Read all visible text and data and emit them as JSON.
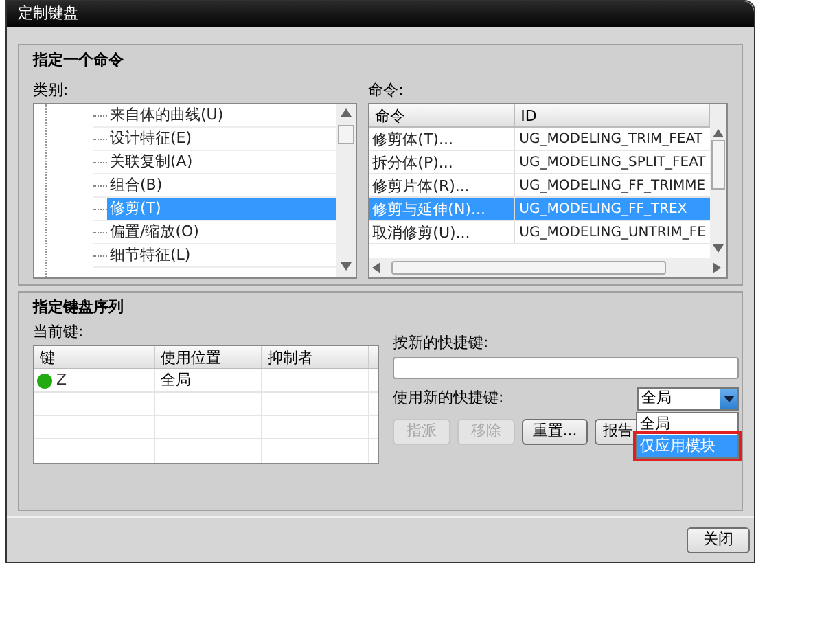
{
  "window": {
    "title": "定制键盘"
  },
  "command_section": {
    "title": "指定一个命令",
    "category_label": "类别:",
    "categories": [
      {
        "label": "来自体的曲线(U)",
        "selected": false
      },
      {
        "label": "设计特征(E)",
        "selected": false
      },
      {
        "label": "关联复制(A)",
        "selected": false
      },
      {
        "label": "组合(B)",
        "selected": false
      },
      {
        "label": "修剪(T)",
        "selected": true
      },
      {
        "label": "偏置/缩放(O)",
        "selected": false
      },
      {
        "label": "细节特征(L)",
        "selected": false
      }
    ],
    "commands_label": "命令:",
    "columns": [
      "命令",
      "ID"
    ],
    "commands": [
      {
        "name": "修剪体(T)...",
        "id": "UG_MODELING_TRIM_FEAT",
        "selected": false
      },
      {
        "name": "拆分体(P)...",
        "id": "UG_MODELING_SPLIT_FEAT",
        "selected": false
      },
      {
        "name": "修剪片体(R)...",
        "id": "UG_MODELING_FF_TRIMME",
        "selected": false
      },
      {
        "name": "修剪与延伸(N)...",
        "id": "UG_MODELING_FF_TREX",
        "selected": true
      },
      {
        "name": "取消修剪(U)...",
        "id": "UG_MODELING_UNTRIM_FE",
        "selected": false
      }
    ]
  },
  "key_section": {
    "title": "指定键盘序列",
    "current_keys_label": "当前键:",
    "columns": [
      "键",
      "使用位置",
      "抑制者"
    ],
    "keys": [
      {
        "key": "Z",
        "location": "全局",
        "color": "#22aa11"
      }
    ],
    "new_key_label": "按新的快捷键:",
    "use_label": "使用新的快捷键:",
    "scope": "全局",
    "scope_options": [
      {
        "label": "全局",
        "selected": false,
        "highlighted": false
      },
      {
        "label": "仅应用模块",
        "selected": true,
        "highlighted": true
      }
    ],
    "buttons": [
      {
        "label": "指派",
        "disabled": true
      },
      {
        "label": "移除",
        "disabled": true
      },
      {
        "label": "重置...",
        "disabled": false
      },
      {
        "label": "报告",
        "disabled": false
      }
    ]
  },
  "footer": {
    "close": "关闭"
  }
}
